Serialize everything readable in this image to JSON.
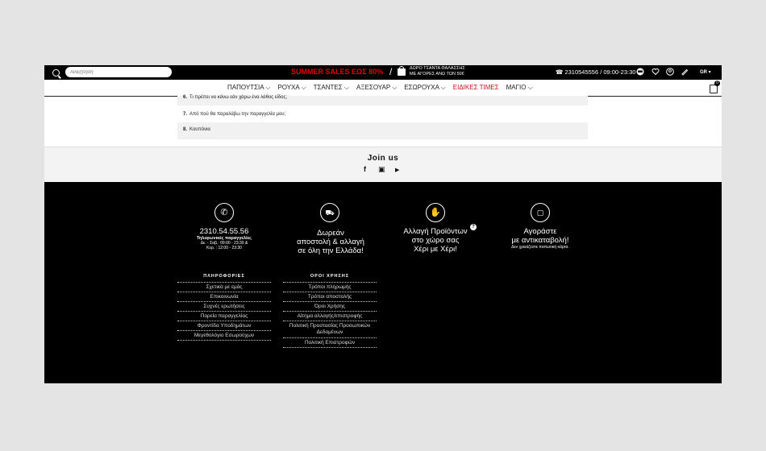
{
  "topbar": {
    "search_placeholder": "Αναζήτηση",
    "promo": "SUMMER SALES ΕΩΣ 80%",
    "slash": "/",
    "gift_line1": "ΔΩΡΟ ΤΣΑΝΤΑ ΘΑΛΑΣΣΗΣ",
    "gift_line2": "ΜΕ ΑΓΟΡΕΣ ΑΝΩ ΤΩΝ 50€",
    "phone": "☎ 2310545556 / 09:00-23:30",
    "lang": "GR ▾"
  },
  "nav": {
    "items": [
      "ΠΑΠΟΥΤΣΙΑ ⌵",
      "ΡΟΥΧΑ ⌵",
      "ΤΣΑΝΤΕΣ ⌵",
      "ΑΞΕΣΟΥΑΡ ⌵",
      "ΕΣΩΡΟΥΧΑ ⌵",
      "ΕΙΔΙΚΕΣ ΤΙΜΕΣ",
      "ΜΑΓΙΟ ⌵"
    ],
    "cart_count": "0"
  },
  "faq": [
    {
      "num": "6.",
      "text": "Τι πρέπει να κάνω εάν χάρω ένα λάθος είδος;"
    },
    {
      "num": "7.",
      "text": "Από πού θα παραλάβω την παραγγελία μου;"
    },
    {
      "num": "8.",
      "text": "Κουπόνια"
    }
  ],
  "join": {
    "title": "Join us",
    "facebook": "f",
    "instagram": "▣",
    "youtube": "▶"
  },
  "features": {
    "phone": {
      "number": "2310.54.55.56",
      "label": "Τηλεφωνικές παραγγελίες",
      "hours1": "Δε. - Σαβ.: 09:00 - 23:30 &",
      "hours2": "Κυρ. : 12:00 - 23:30"
    },
    "shipping": {
      "line1": "Δωρεάν",
      "line2": "αποστολή & αλλαγή",
      "line3": "σε όλη την Ελλάδα!"
    },
    "exchange": {
      "line1": "Αλλαγή Προϊόντων",
      "line2": "στο χώρο σας",
      "line3": "Χέρι με Χέρι!",
      "help": "?"
    },
    "cod": {
      "line1": "Αγοράστε",
      "line2": "με αντικαταβολή!",
      "small": "Δεν χρειάζεστε πιστωτική κάρτα."
    }
  },
  "footer_cols": {
    "info": {
      "title": "ΠΛΗΡΟΦΟΡΙΕΣ",
      "links": [
        "Σχετικά με εμάς",
        "Επικοινωνία",
        "Συχνές ερωτήσεις",
        "Πορεία παραγγελίας",
        "Φροντίδα Υποδημάτων",
        "Μεγεθολόγιο Εσωρούχων"
      ]
    },
    "terms": {
      "title": "ΟΡΟΙ ΧΡΗΣΗΣ",
      "links": [
        "Τρόποι πληρωμής",
        "Τρόποι αποστολής",
        "Όροι Χρήσης",
        "Αίτημα αλλαγής/επιστροφής",
        "Πολιτική Προστασίας Προσωπικών Δεδομένων",
        "Πολιτική Επιστροφών"
      ]
    }
  }
}
